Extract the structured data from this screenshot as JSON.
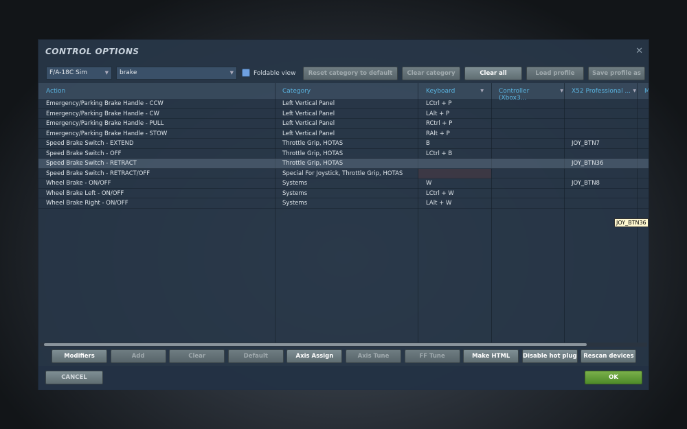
{
  "dialog": {
    "title": "CONTROL OPTIONS",
    "close_icon": "close-icon"
  },
  "toolbar": {
    "aircraft": "F/A-18C Sim",
    "search": "brake",
    "foldable_label": "Foldable view",
    "foldable_checked": true,
    "buttons": [
      "Reset category to default",
      "Clear category",
      "Clear all",
      "Load profile",
      "Save profile as"
    ]
  },
  "table": {
    "headers": [
      "Action",
      "Category",
      "Keyboard",
      "Controller (Xbox3...",
      "X52 Professional ...",
      "M"
    ],
    "rows": [
      [
        "Emergency/Parking Brake Handle - CCW",
        "Left Vertical Panel",
        "LCtrl + P",
        "",
        ""
      ],
      [
        "Emergency/Parking Brake Handle - CW",
        "Left Vertical Panel",
        "LAlt + P",
        "",
        ""
      ],
      [
        "Emergency/Parking Brake Handle - PULL",
        "Left Vertical Panel",
        "RCtrl + P",
        "",
        ""
      ],
      [
        "Emergency/Parking Brake Handle - STOW",
        "Left Vertical Panel",
        "RAlt + P",
        "",
        ""
      ],
      [
        "Speed Brake Switch - EXTEND",
        "Throttle Grip, HOTAS",
        "B",
        "",
        "JOY_BTN7"
      ],
      [
        "Speed Brake Switch - OFF",
        "Throttle Grip, HOTAS",
        "LCtrl + B",
        "",
        ""
      ],
      [
        "Speed Brake Switch - RETRACT",
        "Throttle Grip, HOTAS",
        "",
        "",
        "JOY_BTN36"
      ],
      [
        "Speed Brake Switch - RETRACT/OFF",
        "Special For Joystick, Throttle Grip, HOTAS",
        "",
        "",
        ""
      ],
      [
        "Wheel Brake - ON/OFF",
        "Systems",
        "W",
        "",
        "JOY_BTN8"
      ],
      [
        "Wheel Brake Left - ON/OFF",
        "Systems",
        "LCtrl + W",
        "",
        ""
      ],
      [
        "Wheel Brake Right - ON/OFF",
        "Systems",
        "LAlt + W",
        "",
        ""
      ]
    ],
    "tooltip": "JOY_BTN36"
  },
  "bottom_buttons": [
    "Modifiers",
    "Add",
    "Clear",
    "Default",
    "Axis Assign",
    "Axis Tune",
    "FF Tune",
    "Make HTML",
    "Disable hot plug",
    "Rescan devices"
  ],
  "footer": {
    "cancel": "CANCEL",
    "ok": "OK"
  }
}
